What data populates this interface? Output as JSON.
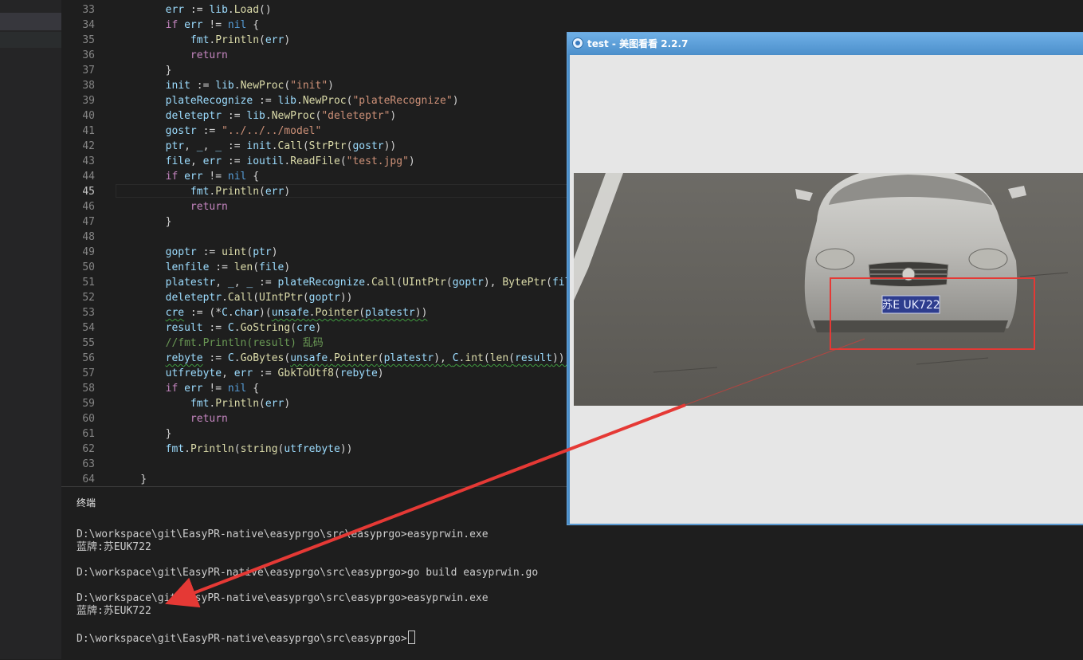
{
  "editor": {
    "lines": [
      {
        "n": "33",
        "html": "        <span class=\"var\">err</span> := <span class=\"var\">lib</span>.<span class=\"fn\">Load</span>()"
      },
      {
        "n": "34",
        "html": "        <span class=\"kw2\">if</span> <span class=\"var\">err</span> != <span class=\"kw\">nil</span> {"
      },
      {
        "n": "35",
        "html": "            <span class=\"var\">fmt</span>.<span class=\"fn\">Println</span>(<span class=\"var\">err</span>)"
      },
      {
        "n": "36",
        "html": "            <span class=\"kw2\">return</span>"
      },
      {
        "n": "37",
        "html": "        }"
      },
      {
        "n": "38",
        "html": "        <span class=\"var\">init</span> := <span class=\"var\">lib</span>.<span class=\"fn\">NewProc</span>(<span class=\"str\">\"init\"</span>)"
      },
      {
        "n": "39",
        "html": "        <span class=\"var\">plateRecognize</span> := <span class=\"var\">lib</span>.<span class=\"fn\">NewProc</span>(<span class=\"str\">\"plateRecognize\"</span>)"
      },
      {
        "n": "40",
        "html": "        <span class=\"var\">deleteptr</span> := <span class=\"var\">lib</span>.<span class=\"fn\">NewProc</span>(<span class=\"str\">\"deleteptr\"</span>)"
      },
      {
        "n": "41",
        "html": "        <span class=\"var\">gostr</span> := <span class=\"str\">\"../../../model\"</span>"
      },
      {
        "n": "42",
        "html": "        <span class=\"var\">ptr</span>, <span class=\"var\">_</span>, <span class=\"var\">_</span> := <span class=\"var\">init</span>.<span class=\"fn\">Call</span>(<span class=\"fn\">StrPtr</span>(<span class=\"var\">gostr</span>))"
      },
      {
        "n": "43",
        "html": "        <span class=\"var\">file</span>, <span class=\"var\">err</span> := <span class=\"var\">ioutil</span>.<span class=\"fn\">ReadFile</span>(<span class=\"str\">\"test.jpg\"</span>)"
      },
      {
        "n": "44",
        "html": "        <span class=\"kw2\">if</span> <span class=\"var\">err</span> != <span class=\"kw\">nil</span> {"
      },
      {
        "n": "45",
        "html": "            <span class=\"var\">fmt</span>.<span class=\"fn\">Println</span>(<span class=\"var\">err</span>)",
        "current": true
      },
      {
        "n": "46",
        "html": "            <span class=\"kw2\">return</span>"
      },
      {
        "n": "47",
        "html": "        }"
      },
      {
        "n": "48",
        "html": ""
      },
      {
        "n": "49",
        "html": "        <span class=\"var\">goptr</span> := <span class=\"fn\">uint</span>(<span class=\"var\">ptr</span>)"
      },
      {
        "n": "50",
        "html": "        <span class=\"var\">lenfile</span> := <span class=\"fn\">len</span>(<span class=\"var\">file</span>)"
      },
      {
        "n": "51",
        "html": "        <span class=\"var\">platestr</span>, <span class=\"var\">_</span>, <span class=\"var\">_</span> := <span class=\"var\">plateRecognize</span>.<span class=\"fn\">Call</span>(<span class=\"fn\">UIntPtr</span>(<span class=\"var\">goptr</span>), <span class=\"fn\">BytePtr</span>(<span class=\"var\">file</span>), I"
      },
      {
        "n": "52",
        "html": "        <span class=\"var\">deleteptr</span>.<span class=\"fn\">Call</span>(<span class=\"fn\">UIntPtr</span>(<span class=\"var\">goptr</span>))"
      },
      {
        "n": "53",
        "html": "        <span class=\"var squig\">cre</span> := (*<span class=\"var\">C</span>.<span class=\"var\">char</span>)(<span class=\"var squig\">unsafe</span><span class=\"squig\">.</span><span class=\"fn squig\">Pointer</span><span class=\"squig\">(</span><span class=\"var squig\">platestr</span><span class=\"squig\">))</span>"
      },
      {
        "n": "54",
        "html": "        <span class=\"var\">result</span> := <span class=\"var\">C</span>.<span class=\"fn\">GoString</span>(<span class=\"var\">cre</span>)"
      },
      {
        "n": "55",
        "html": "        <span class=\"cm\">//fmt.Println(result) 乱码</span>"
      },
      {
        "n": "56",
        "html": "        <span class=\"var squig\">rebyte</span> := <span class=\"var\">C</span>.<span class=\"fn\">GoBytes</span>(<span class=\"var squig\">unsafe</span><span class=\"squig\">.</span><span class=\"fn squig\">Pointer</span><span class=\"squig\">(</span><span class=\"var squig\">platestr</span><span class=\"squig\">), </span><span class=\"var squig\">C</span><span class=\"squig\">.</span><span class=\"fn squig\">int</span><span class=\"squig\">(</span><span class=\"fn squig\">len</span><span class=\"squig\">(</span><span class=\"var squig\">result</span><span class=\"squig\">)))</span>"
      },
      {
        "n": "57",
        "html": "        <span class=\"var\">utfrebyte</span>, <span class=\"var\">err</span> := <span class=\"fn\">GbkToUtf8</span>(<span class=\"var\">rebyte</span>)"
      },
      {
        "n": "58",
        "html": "        <span class=\"kw2\">if</span> <span class=\"var\">err</span> != <span class=\"kw\">nil</span> {"
      },
      {
        "n": "59",
        "html": "            <span class=\"var\">fmt</span>.<span class=\"fn\">Println</span>(<span class=\"var\">err</span>)"
      },
      {
        "n": "60",
        "html": "            <span class=\"kw2\">return</span>"
      },
      {
        "n": "61",
        "html": "        }"
      },
      {
        "n": "62",
        "html": "        <span class=\"var\">fmt</span>.<span class=\"fn\">Println</span>(<span class=\"fn\">string</span>(<span class=\"var\">utfrebyte</span>))"
      },
      {
        "n": "63",
        "html": ""
      },
      {
        "n": "64",
        "html": "    }"
      }
    ]
  },
  "terminal": {
    "title": "终端",
    "lines": [
      "D:\\workspace\\git\\EasyPR-native\\easyprgo\\src\\easyprgo>easyprwin.exe",
      "蓝牌:苏EUK722",
      "",
      "D:\\workspace\\git\\EasyPR-native\\easyprgo\\src\\easyprgo>go build easyprwin.go",
      "",
      "D:\\workspace\\git\\EasyPR-native\\easyprgo\\src\\easyprgo>easyprwin.exe",
      "蓝牌:苏EUK722",
      "",
      "D:\\workspace\\git\\EasyPR-native\\easyprgo\\src\\easyprgo>"
    ]
  },
  "viewer": {
    "title": "test - 美图看看 2.2.7",
    "plate_text": "苏E UK722"
  },
  "colors": {
    "highlight_red": "#e53935",
    "editor_bg": "#1e1e1e",
    "viewer_title_blue": "#4d90cc"
  }
}
